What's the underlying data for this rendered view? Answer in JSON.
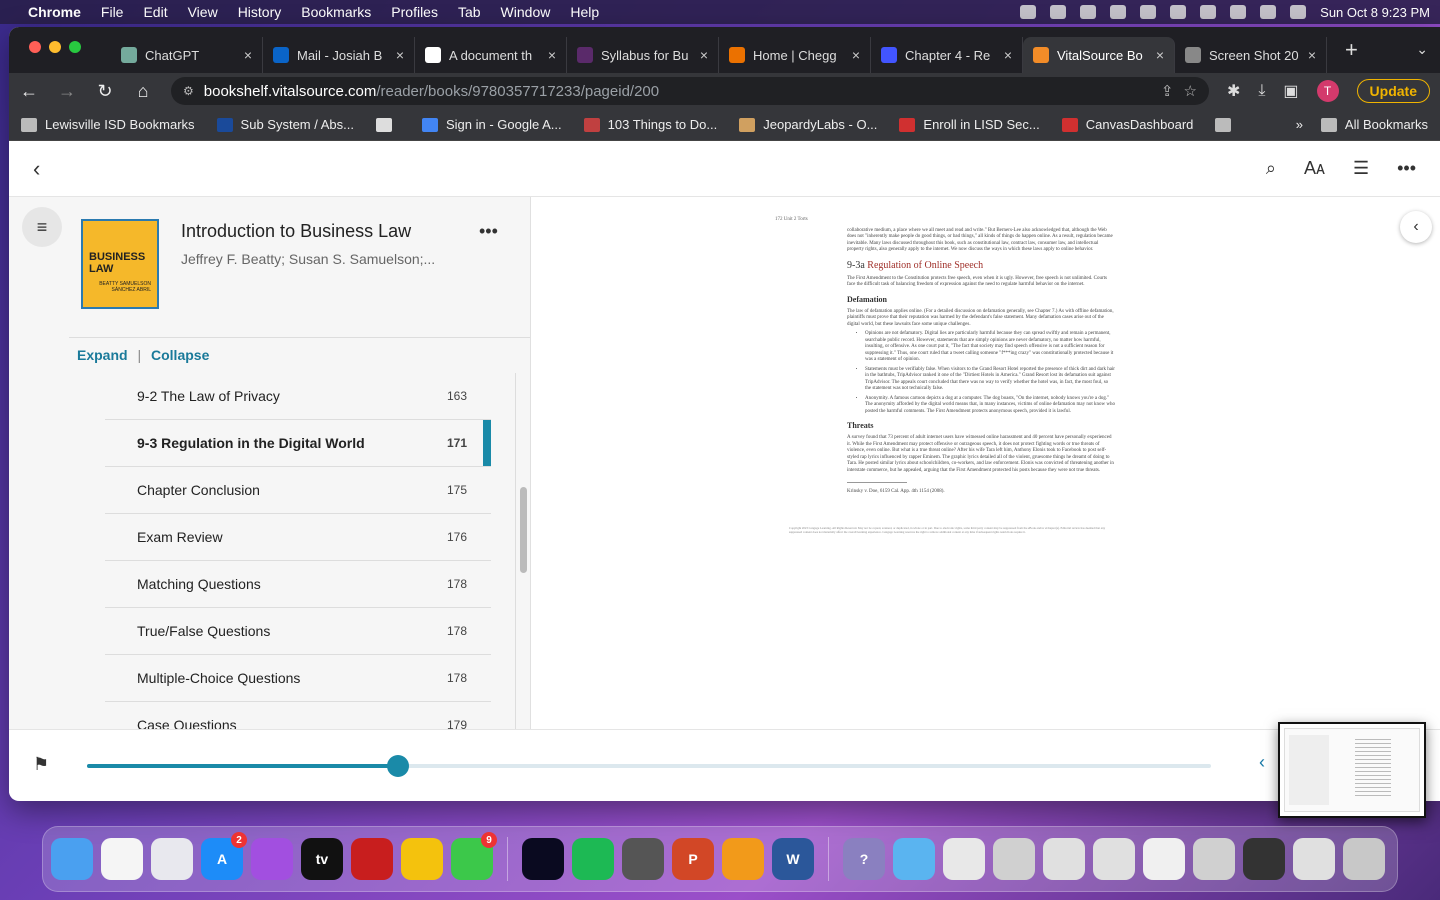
{
  "menubar": {
    "app": "Chrome",
    "items": [
      "File",
      "Edit",
      "View",
      "History",
      "Bookmarks",
      "Profiles",
      "Tab",
      "Window",
      "Help"
    ],
    "datetime": "Sun Oct 8  9:23 PM"
  },
  "tabs": [
    {
      "title": "ChatGPT",
      "color": "#74aa9c"
    },
    {
      "title": "Mail - Josiah B",
      "color": "#0a64c8"
    },
    {
      "title": "A document th",
      "color": "#ffffff"
    },
    {
      "title": "Syllabus for Bu",
      "color": "#5a2a6a"
    },
    {
      "title": "Home | Chegg",
      "color": "#eb7100"
    },
    {
      "title": "Chapter 4 - Re",
      "color": "#4255ff"
    },
    {
      "title": "VitalSource Bo",
      "color": "#f28c28"
    },
    {
      "title": "Screen Shot 20",
      "color": "#888888"
    }
  ],
  "active_tab": 6,
  "address": {
    "domain": "bookshelf.vitalsource.com",
    "path": "/reader/books/9780357717233/pageid/200"
  },
  "update_label": "Update",
  "avatar_letter": "T",
  "bookmarks": [
    {
      "label": "Lewisville ISD Bookmarks",
      "color": "#bbbbbb"
    },
    {
      "label": "Sub System / Abs...",
      "color": "#1a4a9a"
    },
    {
      "label": "",
      "color": "#dddddd"
    },
    {
      "label": "Sign in - Google A...",
      "color": "#4285f4"
    },
    {
      "label": "103 Things to Do...",
      "color": "#c04040"
    },
    {
      "label": "JeopardyLabs - O...",
      "color": "#d0a060"
    },
    {
      "label": "Enroll in LISD Sec...",
      "color": "#d03030"
    },
    {
      "label": "CanvasDashboard",
      "color": "#d03030"
    },
    {
      "label": "",
      "color": "#bbbbbb"
    }
  ],
  "all_bookmarks": "All Bookmarks",
  "book": {
    "title": "Introduction to Business Law",
    "author": "Jeffrey F. Beatty; Susan S. Samuelson;...",
    "cover_text": "BUSINESS LAW",
    "cover_authors": "BEATTY SAMUELSON SÁNCHEZ ABRIL"
  },
  "toc_controls": {
    "expand": "Expand",
    "separator": "|",
    "collapse": "Collapse"
  },
  "toc": [
    {
      "label": "9-2 The Law of Privacy",
      "page": "163",
      "active": false
    },
    {
      "label": "9-3 Regulation in the Digital World",
      "page": "171",
      "active": true
    },
    {
      "label": "Chapter Conclusion",
      "page": "175",
      "active": false
    },
    {
      "label": "Exam Review",
      "page": "176",
      "active": false
    },
    {
      "label": "Matching Questions",
      "page": "178",
      "active": false
    },
    {
      "label": "True/False Questions",
      "page": "178",
      "active": false
    },
    {
      "label": "Multiple-Choice Questions",
      "page": "178",
      "active": false
    },
    {
      "label": "Case Questions",
      "page": "179",
      "active": false
    }
  ],
  "page": {
    "header": "172        Unit 2    Torts",
    "intro": "collaborative medium, a place where we all meet and read and write.\" But Berners-Lee also acknowledged that, although the Web does not \"inherently make people do good things, or bad things,\" all kinds of things do happen online. As a result, regulation became inevitable. Many laws discussed throughout this book, such as constitutional law, contract law, consumer law, and intellectual property rights, also generally apply to the internet. We now discuss the ways in which these laws apply to online behavior.",
    "section_num": "9-3a",
    "section_title": "Regulation of Online Speech",
    "section_text": "The First Amendment to the Constitution protects free speech, even when it is ugly. However, free speech is not unlimited. Courts face the difficult task of balancing freedom of expression against the need to regulate harmful behavior on the internet.",
    "defamation_heading": "Defamation",
    "defamation_text": "The law of defamation applies online. (For a detailed discussion on defamation generally, see Chapter 7.) As with offline defamation, plaintiffs must prove that their reputation was harmed by the defendant's false statement. Many defamation cases arise out of the digital world, but these lawsuits face some unique challenges.",
    "bullets": [
      "Opinions are not defamatory. Digital lies are particularly harmful because they can spread swiftly and remain a permanent, searchable public record. However, statements that are simply opinions are never defamatory, no matter how harmful, insulting, or offensive. As one court put it, \"The fact that society may find speech offensive is not a sufficient reason for suppressing it.\" Thus, one court ruled that a tweet calling someone \"f***ing crazy\" was constitutionally protected because it was a statement of opinion.",
      "Statements must be verifiably false. When visitors to the Grand Resort Hotel reported the presence of thick dirt and dark hair in the bathtubs, TripAdvisor ranked it one of the \"Dirtiest Hotels in America.\" Grand Resort lost its defamation suit against TripAdvisor. The appeals court concluded that there was no way to verify whether the hotel was, in fact, the most foul, so the statement was not technically false.",
      "Anonymity. A famous cartoon depicts a dog at a computer. The dog boasts, \"On the internet, nobody knows you're a dog.\" The anonymity afforded by the digital world means that, in many instances, victims of online defamation may not know who posted the harmful comments. The First Amendment protects anonymous speech, provided it is lawful."
    ],
    "threats_heading": "Threats",
    "threats_text": "A survey found that 73 percent of adult internet users have witnessed online harassment and 40 percent have personally experienced it. While the First Amendment may protect offensive or outrageous speech, it does not protect fighting words or true threats of violence, even online. But what is a true threat online? After his wife Tara left him, Anthony Elonis took to Facebook to post self-styled rap lyrics influenced by rapper Eminem. The graphic lyrics detailed all of the violent, gruesome things he dreamt of doing to Tara. He posted similar lyrics about schoolchildren, co-workers, and law enforcement. Elonis was convicted of threatening another in interstate commerce, but he appealed, arguing that the First Amendment protected his posts because they were not true threats.",
    "footnote": "Krinsky v. Doe, 6159 Cal. App. 4th 1154 (2008).",
    "copyright": "Copyright 2023 Cengage Learning. All Rights Reserved. May not be copied, scanned, or duplicated, in whole or in part. Due to electronic rights, some third party content may be suppressed from the eBook and/or eChapter(s). Editorial review has deemed that any suppressed content does not materially affect the overall learning experience. Cengage Learning reserves the right to remove additional content at any time if subsequent rights restrictions require it."
  },
  "progress": {
    "fraction": 0.277
  },
  "dock": [
    {
      "name": "finder",
      "color": "#4aa0f0",
      "label": ""
    },
    {
      "name": "photos",
      "color": "#f5f5f5",
      "label": ""
    },
    {
      "name": "launchpad",
      "color": "#e8e8ee",
      "label": ""
    },
    {
      "name": "app-store",
      "color": "#1d8cf8",
      "label": "A",
      "badge": "2"
    },
    {
      "name": "podcasts",
      "color": "#a24fe0",
      "label": ""
    },
    {
      "name": "apple-tv",
      "color": "#111111",
      "label": "tv"
    },
    {
      "name": "acrobat",
      "color": "#c81e1e",
      "label": ""
    },
    {
      "name": "chrome",
      "color": "#f4c20d",
      "label": ""
    },
    {
      "name": "messages",
      "color": "#3cc84a",
      "label": "",
      "badge": "9"
    },
    {
      "name": "webex",
      "color": "#0a0a20",
      "label": ""
    },
    {
      "name": "spotify",
      "color": "#1db954",
      "label": ""
    },
    {
      "name": "screenshot",
      "color": "#555555",
      "label": ""
    },
    {
      "name": "powerpoint",
      "color": "#d24726",
      "label": "P"
    },
    {
      "name": "keynote",
      "color": "#f29a1a",
      "label": ""
    },
    {
      "name": "word",
      "color": "#2b579a",
      "label": "W"
    },
    {
      "name": "help",
      "color": "#8a80c0",
      "label": "?"
    },
    {
      "name": "folder",
      "color": "#5ab4f0",
      "label": ""
    },
    {
      "name": "png-file",
      "color": "#e8e8e8",
      "label": ""
    },
    {
      "name": "doc-preview-1",
      "color": "#d0d0d0",
      "label": ""
    },
    {
      "name": "doc-preview-2",
      "color": "#e0e0e0",
      "label": ""
    },
    {
      "name": "doc-preview-3",
      "color": "#e0e0e0",
      "label": ""
    },
    {
      "name": "doc-preview-4",
      "color": "#f0f0f0",
      "label": ""
    },
    {
      "name": "doc-preview-5",
      "color": "#d0d0d0",
      "label": ""
    },
    {
      "name": "doc-preview-6",
      "color": "#333333",
      "label": ""
    },
    {
      "name": "doc-preview-7",
      "color": "#e0e0e0",
      "label": ""
    },
    {
      "name": "trash",
      "color": "#c8c8c8",
      "label": ""
    }
  ]
}
